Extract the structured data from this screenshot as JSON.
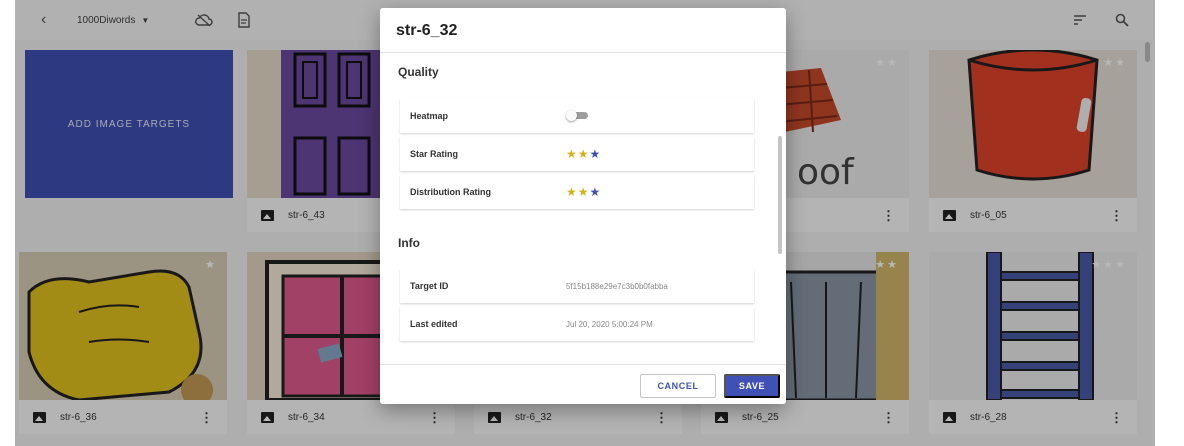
{
  "toolbar": {
    "back_icon": "chevron-left-icon",
    "database_select": "1000Diwords",
    "cloud_icon": "cloud-icon",
    "document_icon": "document-icon",
    "sort_icon": "sort-icon",
    "search_icon": "search-icon"
  },
  "grid": {
    "add_targets_label": "ADD IMAGE TARGETS",
    "cards": [
      {
        "name": "str-6_43",
        "rating": ""
      },
      {
        "name": "",
        "rating": "★★"
      },
      {
        "name": "str-6_05",
        "rating": "★★"
      },
      {
        "name": "str-6_36",
        "rating": "★"
      },
      {
        "name": "str-6_34",
        "rating": ""
      },
      {
        "name": "str-6_32",
        "rating": ""
      },
      {
        "name": "str-6_25",
        "rating": "★★"
      },
      {
        "name": "str-6_28",
        "rating": "★★★"
      }
    ],
    "roof_text": "oof"
  },
  "dialog": {
    "title": "str-6_32",
    "quality": {
      "section_label": "Quality",
      "heatmap_label": "Heatmap",
      "heatmap_on": false,
      "star_rating_label": "Star Rating",
      "star_rating_value": 2,
      "star_rating_max": 3,
      "distribution_rating_label": "Distribution Rating",
      "distribution_rating_value": 2,
      "distribution_rating_max": 3
    },
    "info": {
      "section_label": "Info",
      "target_id_label": "Target ID",
      "target_id_value": "5f15b188e29e7c3b0b0fabba",
      "last_edited_label": "Last edited",
      "last_edited_value": "Jul 20, 2020 5:00:24 PM"
    },
    "cancel_label": "CANCEL",
    "save_label": "SAVE"
  },
  "colors": {
    "primary": "#3f51b5",
    "star_on": "#d4b21e",
    "star_off": "#3f51b5"
  }
}
